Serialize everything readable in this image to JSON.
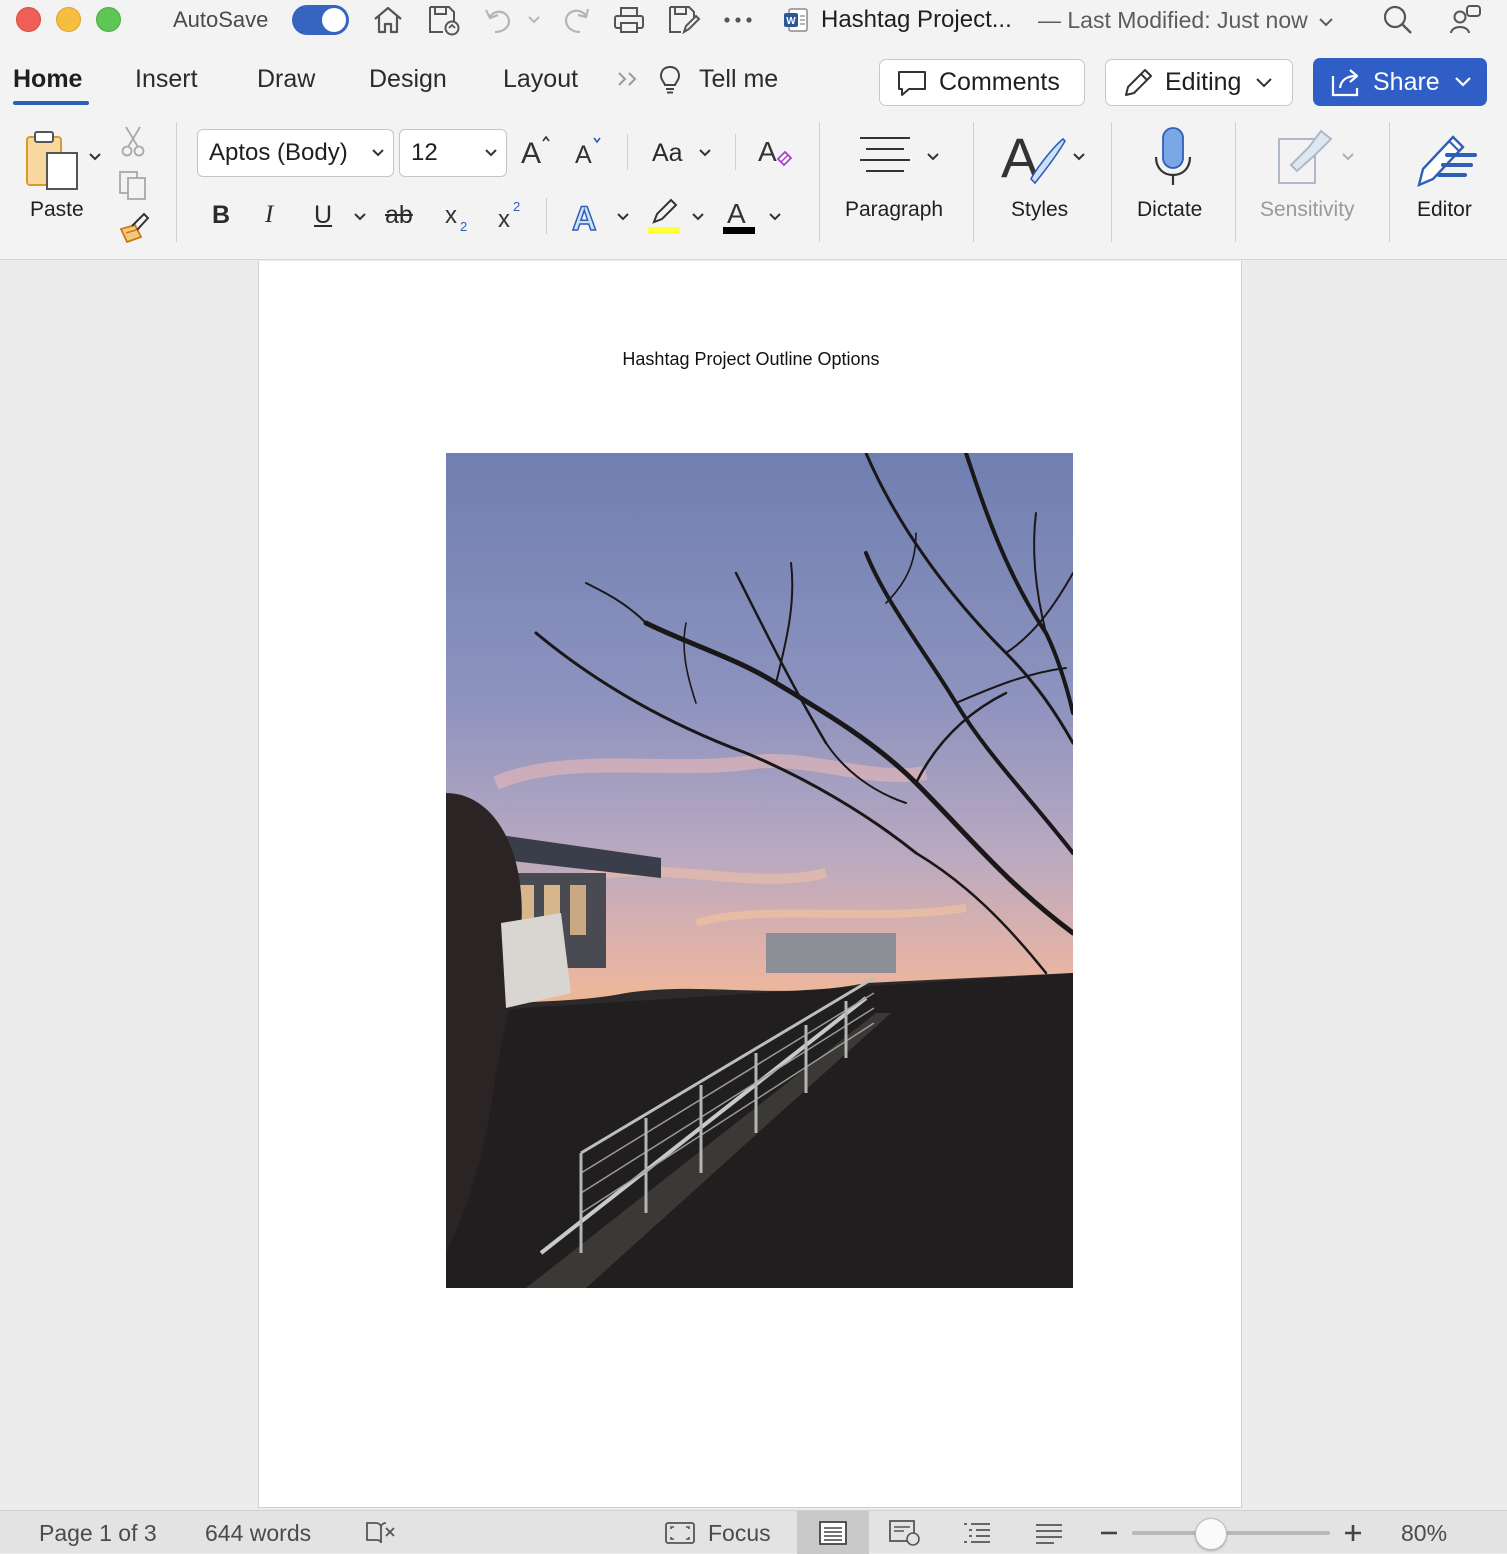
{
  "titlebar": {
    "autosave_label": "AutoSave",
    "autosave_on": true,
    "document_title": "Hashtag Project...",
    "last_modified": "— Last Modified: Just now"
  },
  "tabs": [
    "Home",
    "Insert",
    "Draw",
    "Design",
    "Layout"
  ],
  "active_tab": "Home",
  "tell_me": "Tell me",
  "actions": {
    "comments": "Comments",
    "editing": "Editing",
    "share": "Share"
  },
  "ribbon": {
    "paste_label": "Paste",
    "font_name": "Aptos (Body)",
    "font_size": "12",
    "change_case": "Aa",
    "paragraph_label": "Paragraph",
    "styles_label": "Styles",
    "dictate_label": "Dictate",
    "sensitivity_label": "Sensitivity",
    "editor_label": "Editor",
    "highlight_color": "#ffff3a",
    "font_color": "#000000"
  },
  "document": {
    "heading": "Hashtag Project Outline Options"
  },
  "status": {
    "page": "Page 1 of 3",
    "words": "644 words",
    "focus": "Focus",
    "zoom": "80%",
    "zoom_level": 0.4
  },
  "colors": {
    "accent": "#2f5fc6",
    "toggle": "#3565c0"
  }
}
